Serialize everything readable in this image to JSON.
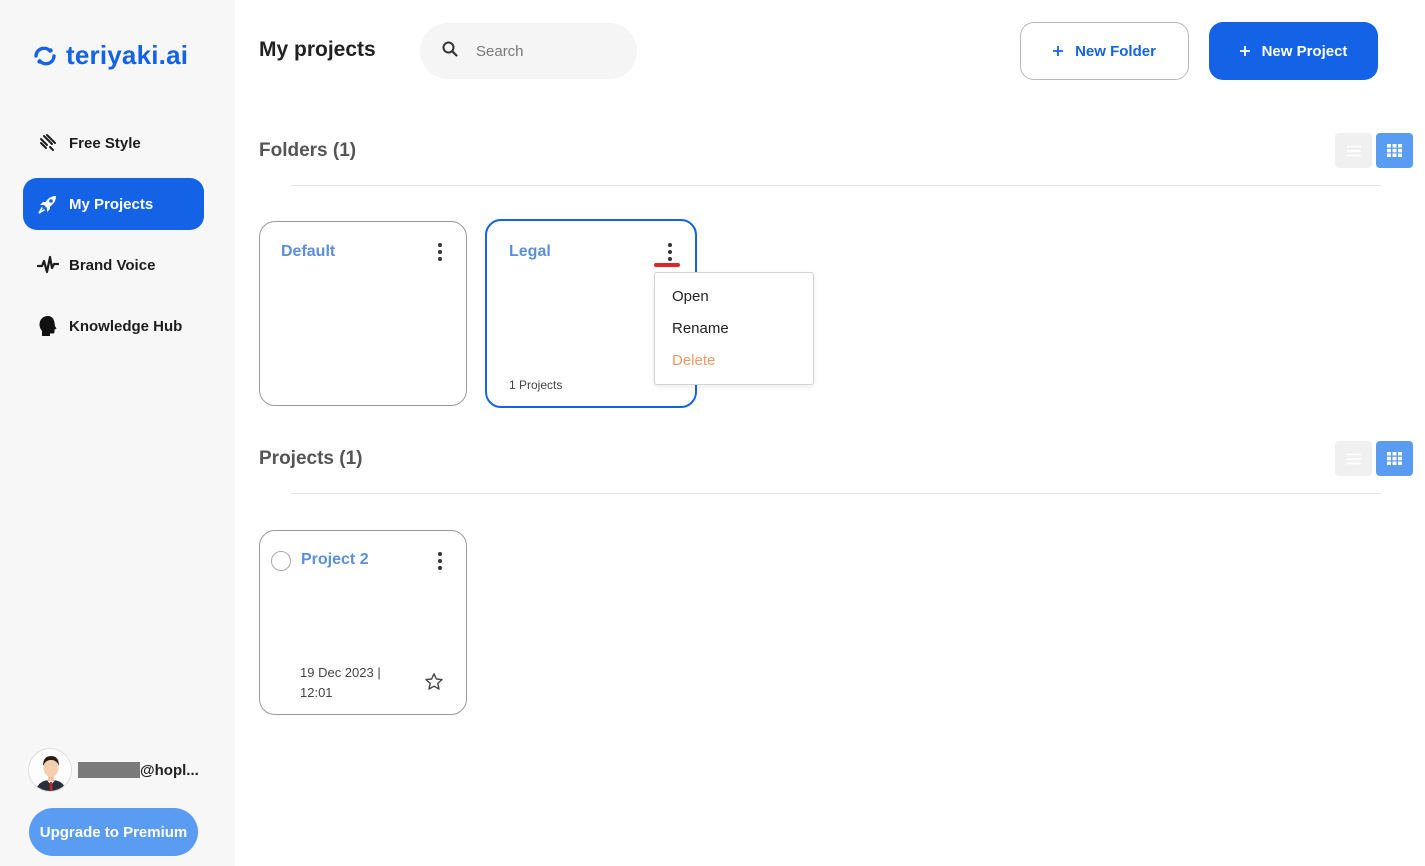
{
  "app": {
    "logo_text": "teriyaki.ai",
    "brand_color": "#1463e6"
  },
  "sidebar": {
    "items": [
      {
        "label": "Free Style",
        "icon": "free-style-icon",
        "active": false
      },
      {
        "label": "My Projects",
        "icon": "rocket-icon",
        "active": true
      },
      {
        "label": "Brand Voice",
        "icon": "waveform-icon",
        "active": false
      },
      {
        "label": "Knowledge Hub",
        "icon": "head-icon",
        "active": false
      }
    ],
    "user": {
      "email_suffix": "@hopl..."
    },
    "upgrade_label": "Upgrade to Premium"
  },
  "header": {
    "title": "My projects",
    "search_placeholder": "Search",
    "new_folder_label": "New Folder",
    "new_project_label": "New Project"
  },
  "folders": {
    "title": "Folders (1)",
    "items": [
      {
        "name": "Default",
        "count": ""
      },
      {
        "name": "Legal",
        "count": "1 Projects"
      }
    ]
  },
  "context_menu": {
    "items": [
      "Open",
      "Rename",
      "Delete"
    ]
  },
  "projects": {
    "title": "Projects (1)",
    "items": [
      {
        "name": "Project 2",
        "date": "19 Dec 2023 |",
        "time": "12:01"
      }
    ]
  }
}
